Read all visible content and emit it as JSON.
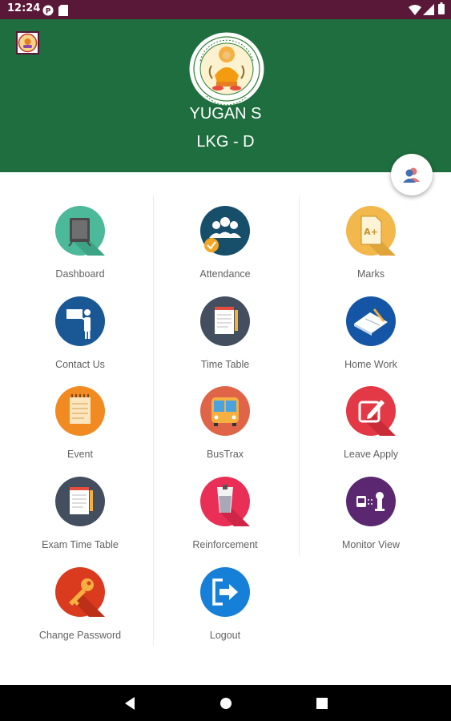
{
  "status_bar": {
    "time": "12:24",
    "icons": [
      "notification-badge-icon",
      "sd-card-icon",
      "wifi-icon",
      "signal-icon",
      "battery-icon"
    ]
  },
  "header": {
    "background": "#1e6e3f",
    "student_name": "YUGAN S",
    "student_class": "LKG - D",
    "logo_icon": "school-crest-icon",
    "menu_logo_icon": "app-logo-icon"
  },
  "profile_button": {
    "icon": "switch-profile-icon"
  },
  "menu": [
    {
      "label": "Dashboard",
      "icon": "dashboard-board-icon",
      "color": "#4cb99a"
    },
    {
      "label": "Attendance",
      "icon": "attendance-group-icon",
      "color": "#174f6b"
    },
    {
      "label": "Marks",
      "icon": "marks-grade-icon",
      "color": "#f2b84b"
    },
    {
      "label": "Contact Us",
      "icon": "contact-presenter-icon",
      "color": "#1a5795"
    },
    {
      "label": "Time Table",
      "icon": "timetable-notepad-icon",
      "color": "#434e5f"
    },
    {
      "label": "Home Work",
      "icon": "homework-book-icon",
      "color": "#1555a5"
    },
    {
      "label": "Event",
      "icon": "event-notepad-icon",
      "color": "#f28a22"
    },
    {
      "label": "BusTrax",
      "icon": "bus-icon",
      "color": "#e06548"
    },
    {
      "label": "Leave Apply",
      "icon": "leave-edit-icon",
      "color": "#e33845"
    },
    {
      "label": "Exam Time Table",
      "icon": "exam-notepad-icon",
      "color": "#434e5f"
    },
    {
      "label": "Reinforcement",
      "icon": "reinforcement-glass-icon",
      "color": "#ea2f56"
    },
    {
      "label": "Monitor View",
      "icon": "monitor-cctv-icon",
      "color": "#5a2770"
    },
    {
      "label": "Change Password",
      "icon": "key-icon",
      "color": "#da3b1f"
    },
    {
      "label": "Logout",
      "icon": "logout-icon",
      "color": "#1680d8"
    }
  ],
  "nav_bar": {
    "icons": [
      "back-icon",
      "home-icon",
      "recents-icon"
    ]
  }
}
